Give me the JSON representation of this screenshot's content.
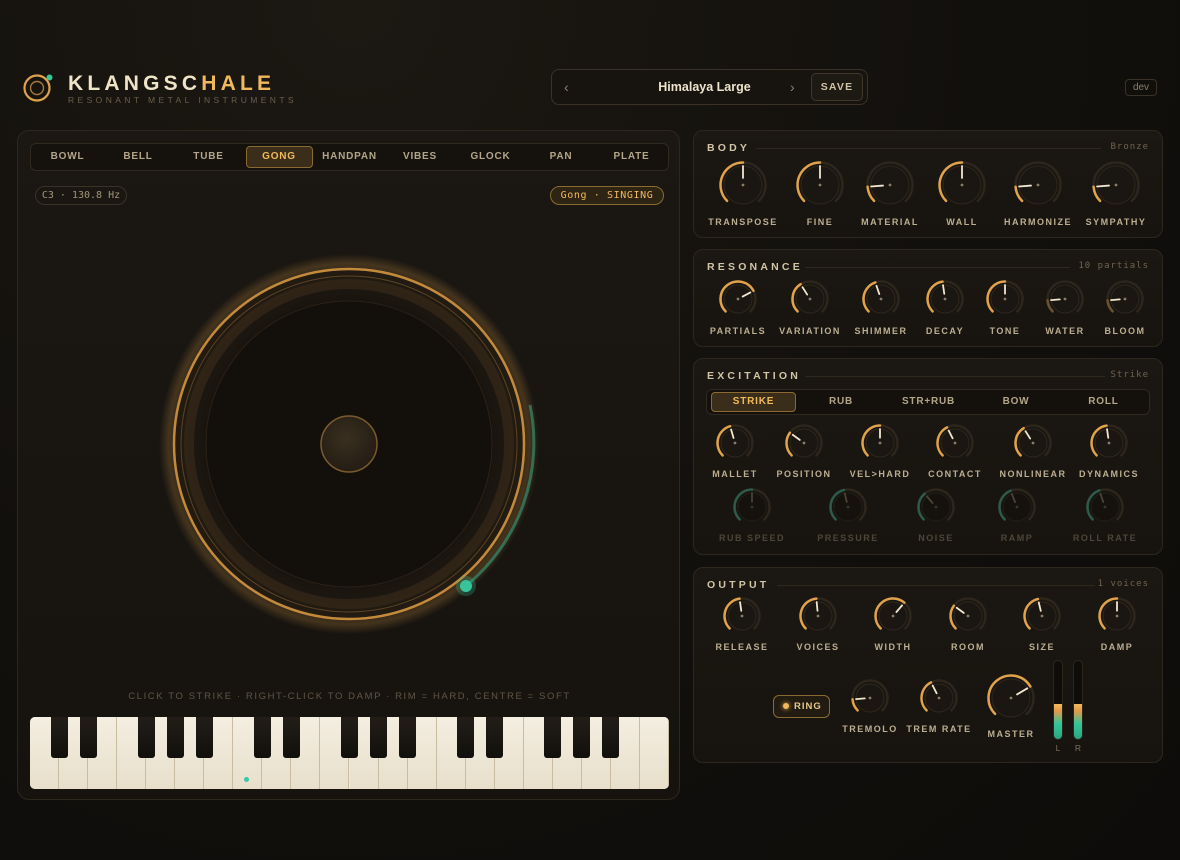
{
  "header": {
    "brand_main": "KLANGSC",
    "brand_accent": "HALE",
    "tagline": "RESONANT METAL INSTRUMENTS",
    "preset_prev": "‹",
    "preset_name": "Himalaya Large",
    "preset_next": "›",
    "save_label": "SAVE",
    "dev_label": "dev"
  },
  "instrument": {
    "tabs": [
      "BOWL",
      "BELL",
      "TUBE",
      "GONG",
      "HANDPAN",
      "VIBES",
      "GLOCK",
      "PAN",
      "PLATE"
    ],
    "active_tab": "GONG",
    "note": "C3 · 130.8 Hz",
    "mode": "Gong · SINGING",
    "hint": "CLICK TO STRIKE · RIGHT-CLICK TO DAMP · RIM = HARD, CENTRE = SOFT"
  },
  "body": {
    "title": "BODY",
    "right": "Bronze",
    "knobs": [
      {
        "label": "TRANSPOSE",
        "value": 0.5
      },
      {
        "label": "FINE",
        "value": 0.5
      },
      {
        "label": "MATERIAL",
        "value": 0.15
      },
      {
        "label": "WALL",
        "value": 0.5
      },
      {
        "label": "HARMONIZE",
        "value": 0.15
      },
      {
        "label": "SYMPATHY",
        "value": 0.15
      }
    ]
  },
  "resonance": {
    "title": "RESONANCE",
    "right": "10 partials",
    "knobs": [
      {
        "label": "PARTIALS",
        "value": 0.73
      },
      {
        "label": "VARIATION",
        "value": 0.38
      },
      {
        "label": "SHIMMER",
        "value": 0.43
      },
      {
        "label": "DECAY",
        "value": 0.47
      },
      {
        "label": "TONE",
        "value": 0.5
      },
      {
        "label": "WATER",
        "value": 0.15
      },
      {
        "label": "BLOOM",
        "value": 0.15
      }
    ]
  },
  "excitation": {
    "title": "EXCITATION",
    "right": "Strike",
    "modes": [
      "STRIKE",
      "RUB",
      "STR+RUB",
      "BOW",
      "ROLL"
    ],
    "active_mode": "STRIKE",
    "knobs": [
      {
        "label": "MALLET",
        "value": 0.44
      },
      {
        "label": "POSITION",
        "value": 0.3
      },
      {
        "label": "VEL>HARD",
        "value": 0.5
      },
      {
        "label": "CONTACT",
        "value": 0.4
      },
      {
        "label": "NONLINEAR",
        "value": 0.38
      },
      {
        "label": "DYNAMICS",
        "value": 0.47
      }
    ],
    "dim_knobs": [
      {
        "label": "RUB SPEED",
        "value": 0.5
      },
      {
        "label": "PRESSURE",
        "value": 0.45
      },
      {
        "label": "NOISE",
        "value": 0.35
      },
      {
        "label": "RAMP",
        "value": 0.42
      },
      {
        "label": "ROLL RATE",
        "value": 0.43
      }
    ]
  },
  "output": {
    "title": "OUTPUT",
    "right": "1 voices",
    "knobs": [
      {
        "label": "RELEASE",
        "value": 0.47
      },
      {
        "label": "VOICES",
        "value": 0.48
      },
      {
        "label": "WIDTH",
        "value": 0.65
      },
      {
        "label": "ROOM",
        "value": 0.3
      },
      {
        "label": "SIZE",
        "value": 0.45
      },
      {
        "label": "DAMP",
        "value": 0.5
      }
    ],
    "ring_label": "RING",
    "small_knobs": [
      {
        "label": "TREMOLO",
        "value": 0.15
      },
      {
        "label": "TREM RATE",
        "value": 0.4
      }
    ],
    "master": {
      "label": "MASTER",
      "value": 0.72
    },
    "meters": [
      {
        "label": "L",
        "level": 0.45
      },
      {
        "label": "R",
        "level": 0.45
      }
    ]
  },
  "colors": {
    "accent": "#f2b95c",
    "teal": "#38c59a",
    "bg": "#12100d"
  }
}
